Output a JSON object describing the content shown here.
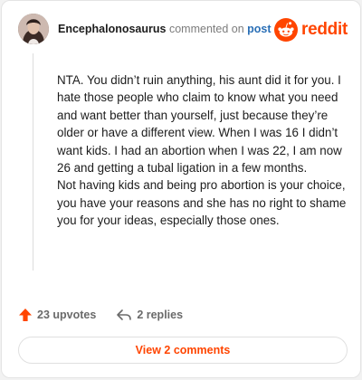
{
  "header": {
    "username": "Encephalonosaurus",
    "action_text": "commented on",
    "post_link": "post",
    "brand_name": "reddit",
    "avatar_icon": "user-avatar-photo",
    "brand_icon": "reddit-snoo-icon"
  },
  "comment": {
    "body": "NTA. You didn’t ruin anything, his aunt did it for you. I hate those people who claim to know what you need and want better than yourself, just because they’re older or have a different view. When I was 16 I didn’t want kids. I had an abortion when I was 22, I am now 26 and getting a tubal ligation in a few months.\nNot having kids and being pro abortion is your choice, you have your reasons and she has no right to shame you for your ideas, especially those ones."
  },
  "footer": {
    "upvotes_label": "23 upvotes",
    "replies_label": "2 replies",
    "upvote_icon": "upvote-arrow-icon",
    "reply_icon": "reply-arrow-icon"
  },
  "view_button": {
    "label": "View 2 comments"
  },
  "colors": {
    "brand": "#ff4500",
    "link": "#2a6fb6",
    "text": "#1c1c1c",
    "muted": "#7c7c7c"
  }
}
